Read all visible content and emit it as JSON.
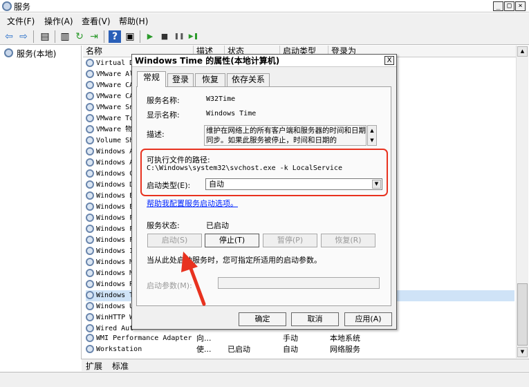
{
  "window": {
    "title": "服务"
  },
  "menu": {
    "items": [
      "文件(F)",
      "操作(A)",
      "查看(V)",
      "帮助(H)"
    ]
  },
  "toolbar": {
    "icons": [
      "back-arrow",
      "forward-arrow",
      "show-hide-tree",
      "properties",
      "refresh",
      "export-list",
      "help",
      "console-view",
      "start",
      "stop",
      "pause",
      "restart"
    ],
    "glyphs": [
      "⇦",
      "⇨",
      "▤",
      "▥",
      "↻",
      "⇥",
      "?",
      "▣",
      "▶",
      "■",
      "❚❚",
      "▶❚"
    ]
  },
  "tree": {
    "root_label": "服务(本地)"
  },
  "list": {
    "columns": [
      "名称",
      "描述",
      "状态",
      "启动类型",
      "登录为"
    ],
    "rows": [
      "Virtual D",
      "VMware Al",
      "VMware CA",
      "VMware CA",
      "VMware Sn",
      "VMware To",
      "VMware 物",
      "Volume Sh",
      "Windows A",
      "Windows A",
      "Windows C",
      "Windows D",
      "Windows E",
      "Windows E",
      "Windows F",
      "Windows F",
      "Windows F",
      "Windows I",
      "Windows M",
      "Windows M",
      "Windows R",
      "Windows T",
      "Windows U",
      "WinHTTP W",
      "Wired Aut"
    ],
    "selected_row": 21,
    "full_rows": [
      {
        "name": "WMI Performance Adapter",
        "desc": "向...",
        "status": "",
        "startup": "手动",
        "logon": "本地系统"
      },
      {
        "name": "Workstation",
        "desc": "使...",
        "status": "已启动",
        "startup": "自动",
        "logon": "网络服务"
      }
    ]
  },
  "bottom_tabs": [
    "扩展",
    "标准"
  ],
  "dialog": {
    "title": "Windows Time 的属性(本地计算机)",
    "close": "X",
    "tabs": [
      "常规",
      "登录",
      "恢复",
      "依存关系"
    ],
    "service_name_label": "服务名称:",
    "service_name": "W32Time",
    "display_name_label": "显示名称:",
    "display_name": "Windows Time",
    "description_label": "描述:",
    "description": "维护在网络上的所有客户端和服务器的时间和日期同步。如果此服务被停止，时间和日期的",
    "exe_path_label": "可执行文件的路径:",
    "exe_path": "C:\\Windows\\system32\\svchost.exe -k LocalService",
    "startup_type_label": "启动类型(E):",
    "startup_type": "自动",
    "help_link": "帮助我配置服务启动选项。",
    "service_status_label": "服务状态:",
    "service_status": "已启动",
    "buttons": {
      "start": "启动(S)",
      "stop": "停止(T)",
      "pause": "暂停(P)",
      "resume": "恢复(R)"
    },
    "hint": "当从此处启动服务时，您可指定所适用的启动参数。",
    "start_params_label": "启动参数(M):",
    "ok": "确定",
    "cancel": "取消",
    "apply": "应用(A)"
  },
  "colors": {
    "highlight_box": "#e8321f",
    "annotation_arrow": "#e8321f",
    "link": "#0026ff"
  }
}
